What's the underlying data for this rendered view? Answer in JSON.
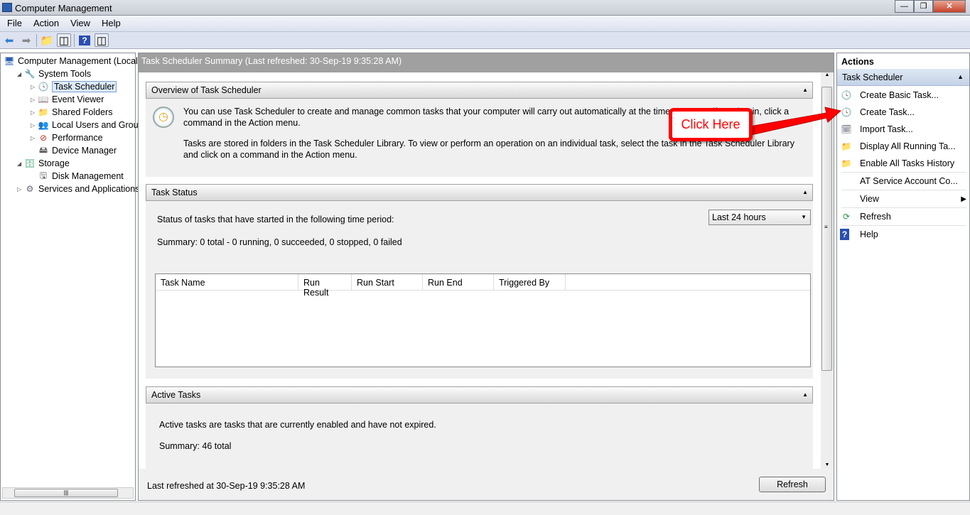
{
  "window": {
    "title": "Computer Management",
    "controls": [
      "minimize",
      "maximize",
      "close"
    ]
  },
  "menu": [
    "File",
    "Action",
    "View",
    "Help"
  ],
  "toolbar": [
    "back-icon",
    "forward-icon",
    "up-folder-icon",
    "show-hide-tree-icon",
    "help-icon",
    "show-hide-action-pane-icon"
  ],
  "tree": [
    {
      "label": "Computer Management (Local",
      "icon": "computer-icon",
      "level": 0,
      "expander": ""
    },
    {
      "label": "System Tools",
      "icon": "tools-icon",
      "level": 1,
      "expander": "expanded"
    },
    {
      "label": "Task Scheduler",
      "icon": "clock-icon",
      "level": 2,
      "expander": "collapsed",
      "selected": true
    },
    {
      "label": "Event Viewer",
      "icon": "event-viewer-icon",
      "level": 2,
      "expander": "collapsed"
    },
    {
      "label": "Shared Folders",
      "icon": "shared-folder-icon",
      "level": 2,
      "expander": "collapsed"
    },
    {
      "label": "Local Users and Groups",
      "icon": "users-icon",
      "level": 2,
      "expander": "collapsed"
    },
    {
      "label": "Performance",
      "icon": "performance-icon",
      "level": 2,
      "expander": "collapsed"
    },
    {
      "label": "Device Manager",
      "icon": "device-manager-icon",
      "level": 2,
      "expander": ""
    },
    {
      "label": "Storage",
      "icon": "storage-icon",
      "level": 1,
      "expander": "expanded"
    },
    {
      "label": "Disk Management",
      "icon": "disk-icon",
      "level": 2,
      "expander": ""
    },
    {
      "label": "Services and Applications",
      "icon": "services-icon",
      "level": 1,
      "expander": "collapsed"
    }
  ],
  "main": {
    "header": "Task Scheduler Summary (Last refreshed: 30-Sep-19 9:35:28 AM)",
    "overview": {
      "title": "Overview of Task Scheduler",
      "p1": "You can use Task Scheduler to create and manage common tasks that your computer will carry out automatically at the times you specify. To begin, click a command in the Action menu.",
      "p2": "Tasks are stored in folders in the Task Scheduler Library. To view or perform an operation on an individual task, select the task in the Task Scheduler Library and click on a command in the Action menu."
    },
    "status": {
      "title": "Task Status",
      "period_label": "Status of tasks that have started in the following time period:",
      "period_value": "Last 24 hours",
      "summary": "Summary: 0 total - 0 running, 0 succeeded, 0 stopped, 0 failed",
      "columns": [
        "Task Name",
        "Run Result",
        "Run Start",
        "Run End",
        "Triggered By"
      ]
    },
    "active": {
      "title": "Active Tasks",
      "text": "Active tasks are tasks that are currently enabled and have not expired.",
      "summary": "Summary: 46 total"
    },
    "footer": {
      "last_refreshed": "Last refreshed at 30-Sep-19 9:35:28 AM",
      "refresh": "Refresh"
    }
  },
  "actions": {
    "title": "Actions",
    "section": "Task Scheduler",
    "items": [
      {
        "label": "Create Basic Task...",
        "icon": "create-basic-task-icon"
      },
      {
        "label": "Create Task...",
        "icon": "create-task-icon"
      },
      {
        "label": "Import Task...",
        "icon": "import-task-icon"
      },
      {
        "label": "Display All Running Ta...",
        "icon": "running-tasks-folder-icon"
      },
      {
        "label": "Enable All Tasks History",
        "icon": "folder-icon"
      },
      {
        "label": "AT Service Account Co...",
        "icon": ""
      },
      {
        "label": "View",
        "icon": "",
        "submenu": true
      },
      {
        "label": "Refresh",
        "icon": "refresh-icon"
      },
      {
        "label": "Help",
        "icon": "help-icon"
      }
    ]
  },
  "annotation": {
    "callout": "Click Here",
    "color": "#ff0000"
  }
}
